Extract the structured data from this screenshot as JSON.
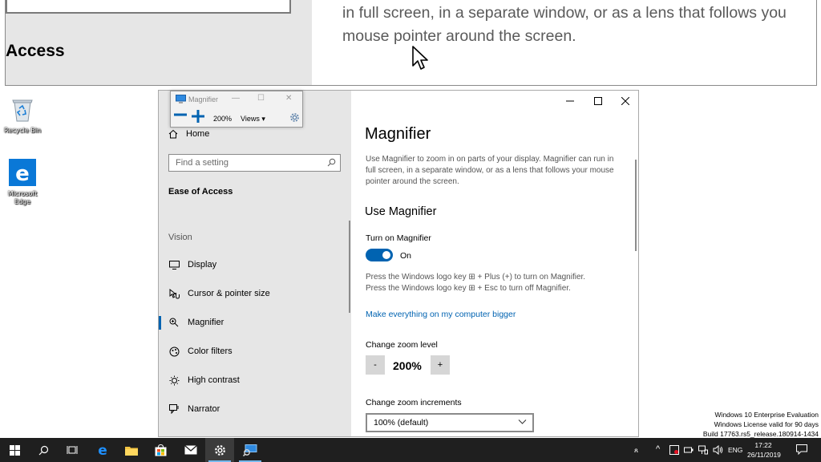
{
  "lens": {
    "heading": "Access",
    "line1": "in full screen, in a separate window, or as a lens that follows you",
    "line2": "mouse pointer around the screen."
  },
  "desktop": {
    "icons": [
      {
        "label": "Recycle Bin",
        "icon": "recycle-bin-icon"
      },
      {
        "label": "Microsoft Edge",
        "icon": "edge-icon"
      }
    ]
  },
  "magnifier_toolbar": {
    "title": "Magnifier",
    "zoom": "200%",
    "views_label": "Views"
  },
  "settings": {
    "nav": {
      "home": "Home",
      "search_placeholder": "Find a setting",
      "section": "Ease of Access",
      "group": "Vision",
      "items": [
        {
          "label": "Display",
          "icon": "display-icon"
        },
        {
          "label": "Cursor & pointer size",
          "icon": "cursor-icon"
        },
        {
          "label": "Magnifier",
          "icon": "magnifier-icon",
          "active": true
        },
        {
          "label": "Color filters",
          "icon": "color-filters-icon"
        },
        {
          "label": "High contrast",
          "icon": "high-contrast-icon"
        },
        {
          "label": "Narrator",
          "icon": "narrator-icon"
        }
      ]
    },
    "content": {
      "title": "Magnifier",
      "description": "Use Magnifier to zoom in on parts of your display. Magnifier can run in full screen, in a separate window, or as a lens that follows your mouse pointer around the screen.",
      "use_heading": "Use Magnifier",
      "turn_on_label": "Turn on Magnifier",
      "toggle_state": "On",
      "hint_line1": "Press the Windows logo key ⊞ + Plus (+) to turn on Magnifier.",
      "hint_line2": "Press the Windows logo key ⊞ + Esc to turn off Magnifier.",
      "link": "Make everything on my computer bigger",
      "zoom_level_label": "Change zoom level",
      "zoom_minus": "-",
      "zoom_value": "200%",
      "zoom_plus": "+",
      "increments_label": "Change zoom increments",
      "increments_value": "100% (default)"
    }
  },
  "watermark": {
    "line1": "Windows 10 Enterprise Evaluation",
    "line2": "Windows License valid for 90 days",
    "line3": "Build 17763.rs5_release.180914-1434"
  },
  "taskbar": {
    "language": "ENG",
    "time": "17:22",
    "date": "26/11/2019",
    "accent": "#0063b1"
  }
}
